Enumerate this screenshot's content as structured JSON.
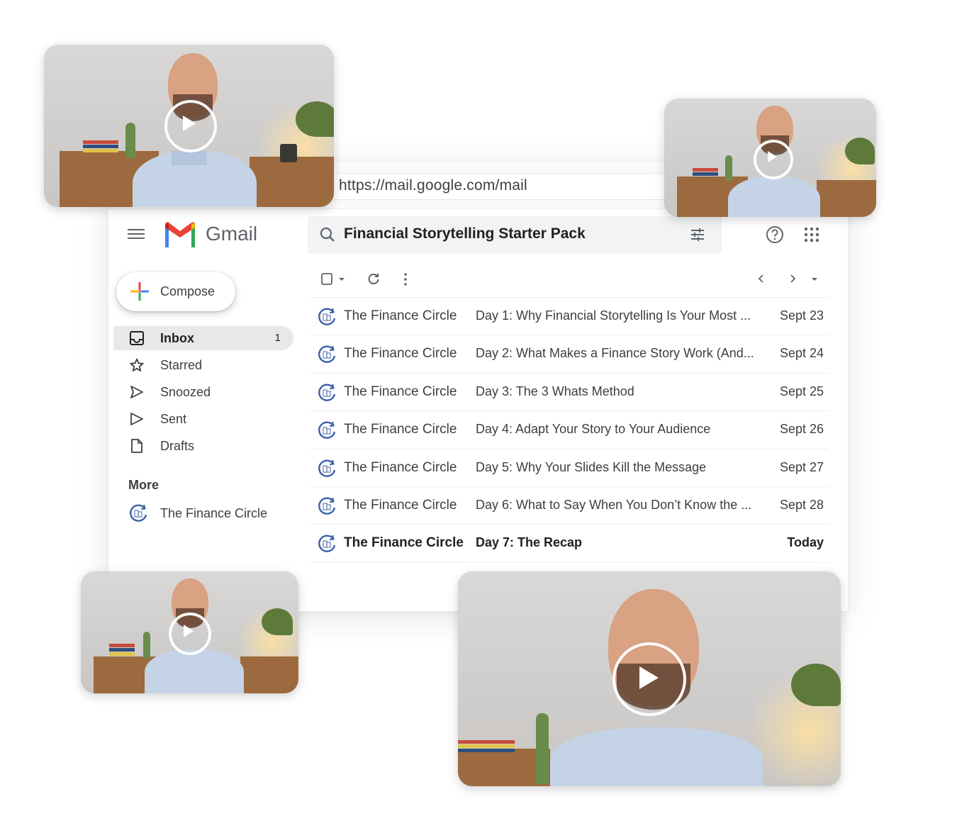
{
  "browser": {
    "url": "https://mail.google.com/mail"
  },
  "app": {
    "name": "Gmail"
  },
  "search": {
    "query": "Financial Storytelling Starter Pack"
  },
  "sidebar": {
    "compose_label": "Compose",
    "items": [
      {
        "label": "Inbox",
        "icon": "inbox-icon",
        "count": "1",
        "active": true
      },
      {
        "label": "Starred",
        "icon": "star-icon"
      },
      {
        "label": "Snoozed",
        "icon": "snoozed-icon"
      },
      {
        "label": "Sent",
        "icon": "send-icon"
      },
      {
        "label": "Drafts",
        "icon": "draft-icon"
      }
    ],
    "more_label": "More",
    "labels": [
      {
        "label": "The Finance Circle",
        "icon": "finance-circle-logo-icon"
      }
    ]
  },
  "emails": [
    {
      "sender": "The Finance Circle",
      "subject": "Day 1: Why Financial Storytelling Is Your Most ...",
      "date": "Sept 23",
      "unread": false
    },
    {
      "sender": "The Finance Circle",
      "subject": "Day 2: What Makes a Finance Story Work (And...",
      "date": "Sept 24",
      "unread": false
    },
    {
      "sender": "The Finance Circle",
      "subject": "Day 3: The 3 Whats Method",
      "date": "Sept 25",
      "unread": false
    },
    {
      "sender": "The Finance Circle",
      "subject": "Day 4: Adapt Your Story to Your Audience",
      "date": "Sept 26",
      "unread": false
    },
    {
      "sender": "The Finance Circle",
      "subject": "Day 5: Why Your Slides Kill the Message",
      "date": "Sept 27",
      "unread": false
    },
    {
      "sender": "The Finance Circle",
      "subject": "Day 6: What to Say When You Don’t Know the ...",
      "date": "Sept 28",
      "unread": false
    },
    {
      "sender": "The Finance Circle",
      "subject": "Day 7: The Recap",
      "date": "Today",
      "unread": true
    }
  ],
  "colors": {
    "gmail_red": "#EA4335",
    "gmail_blue": "#4285F4",
    "gmail_green": "#34A853",
    "gmail_yellow": "#FBBC04",
    "logo_blue": "#3b5fa8"
  }
}
